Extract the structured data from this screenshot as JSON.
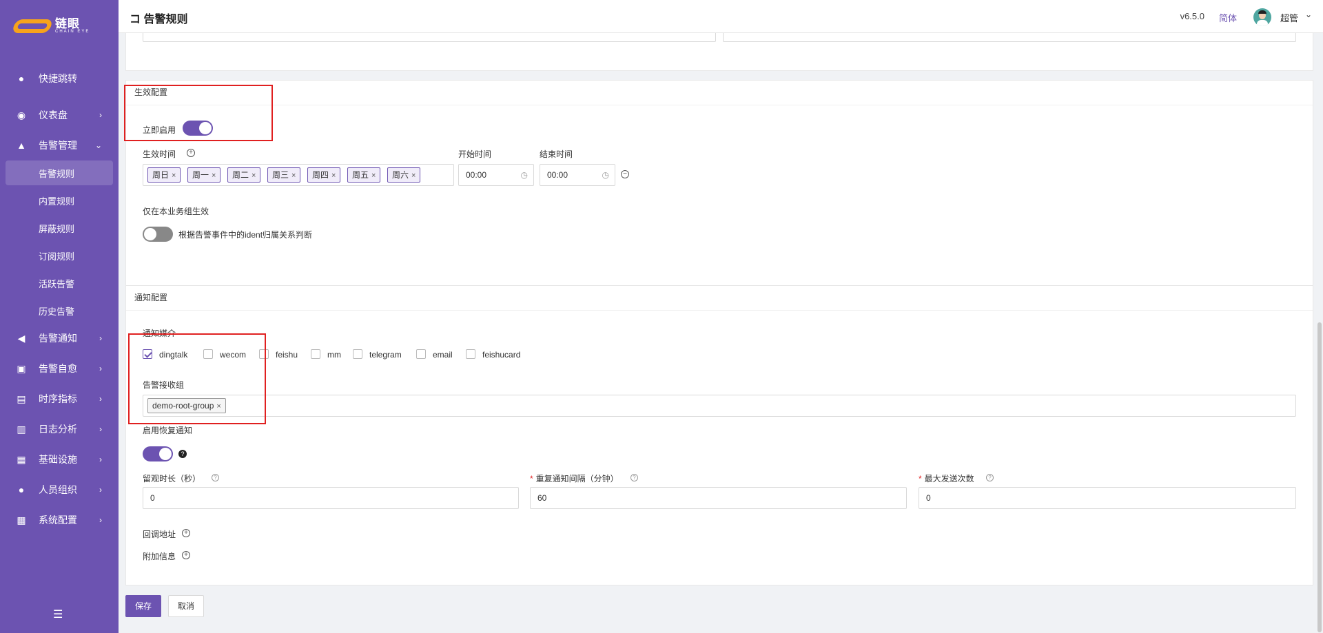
{
  "sidebar": {
    "logo_text": "链眼",
    "logo_sub": "CHAIN EYE",
    "items": [
      {
        "label": "快捷跳转",
        "icon": "search-icon",
        "glyph": "●"
      },
      {
        "label": "仪表盘",
        "icon": "dashboard-icon",
        "glyph": "◉",
        "arrow": "›"
      },
      {
        "label": "告警管理",
        "icon": "alarm-icon",
        "glyph": "▲",
        "arrow": "⌄"
      },
      {
        "label": "告警通知",
        "icon": "megaphone-icon",
        "glyph": "◀",
        "arrow": "›"
      },
      {
        "label": "告警自愈",
        "icon": "terminal-icon",
        "glyph": "▣",
        "arrow": "›"
      },
      {
        "label": "时序指标",
        "icon": "chart-icon",
        "glyph": "▤",
        "arrow": "›"
      },
      {
        "label": "日志分析",
        "icon": "log-icon",
        "glyph": "▥",
        "arrow": "›"
      },
      {
        "label": "基础设施",
        "icon": "server-icon",
        "glyph": "▦",
        "arrow": "›"
      },
      {
        "label": "人员组织",
        "icon": "user-icon",
        "glyph": "●",
        "arrow": "›"
      },
      {
        "label": "系统配置",
        "icon": "grid-icon",
        "glyph": "▩",
        "arrow": "›"
      }
    ],
    "sub_items": [
      "告警规则",
      "内置规则",
      "屏蔽规则",
      "订阅规则",
      "活跃告警",
      "历史告警"
    ],
    "collapse_glyph": "☰"
  },
  "header": {
    "title_glyph": "コ",
    "title": "告警规则",
    "version": "v6.5.0",
    "lang": "简体",
    "user": "超管",
    "chevron": "⌄"
  },
  "effective": {
    "section_title": "生效配置",
    "enable_label": "立即启用",
    "time_label": "生效时间",
    "add_glyph": "+",
    "days": [
      "周日",
      "周一",
      "周二",
      "周三",
      "周四",
      "周五",
      "周六"
    ],
    "tag_close": "×",
    "start_label": "开始时间",
    "end_label": "结束时间",
    "start_value": "00:00",
    "end_value": "00:00",
    "clock_glyph": "◷",
    "remove_glyph": "−",
    "biz_label": "仅在本业务组生效",
    "biz_desc": "根据告警事件中的ident归属关系判断"
  },
  "notify": {
    "section_title": "通知配置",
    "media_label": "通知媒介",
    "channels": [
      {
        "label": "dingtalk",
        "checked": true
      },
      {
        "label": "wecom",
        "checked": false
      },
      {
        "label": "feishu",
        "checked": false
      },
      {
        "label": "mm",
        "checked": false
      },
      {
        "label": "telegram",
        "checked": false
      },
      {
        "label": "email",
        "checked": false
      },
      {
        "label": "feishucard",
        "checked": false
      }
    ],
    "receiver_label": "告警接收组",
    "receiver_tag": "demo-root-group",
    "recover_label": "启用恢复通知",
    "help_glyph": "?",
    "observe_label": "留观时长（秒）",
    "observe_value": "0",
    "repeat_label": "重复通知间隔（分钟）",
    "repeat_value": "60",
    "max_label": "最大发送次数",
    "max_value": "0",
    "required_mark": "*",
    "callback_label": "回调地址",
    "extra_label": "附加信息"
  },
  "actions": {
    "save": "保存",
    "cancel": "取消"
  }
}
